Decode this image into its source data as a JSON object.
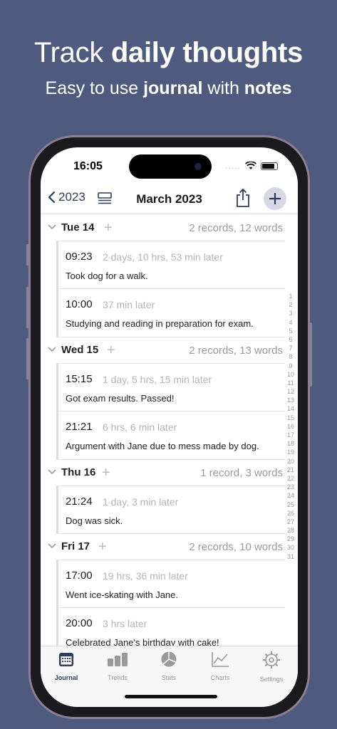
{
  "promo": {
    "title_plain": "Track ",
    "title_bold": "daily thoughts",
    "sub_plain": "Easy to use ",
    "sub_bold1": "journal",
    "sub_mid": " with ",
    "sub_bold2": "notes"
  },
  "status": {
    "time": "16:05",
    "dots": "....."
  },
  "nav": {
    "back_label": "2023",
    "title": "March 2023"
  },
  "days": [
    {
      "label": "Tue 14",
      "summary": "2 records, 12 words",
      "entries": [
        {
          "time": "09:23",
          "relative": "2 days, 10 hrs, 53 min later",
          "text": "Took dog for a walk."
        },
        {
          "time": "10:00",
          "relative": "37 min later",
          "text": "Studying and reading in preparation for exam."
        }
      ]
    },
    {
      "label": "Wed 15",
      "summary": "2 records, 13 words",
      "entries": [
        {
          "time": "15:15",
          "relative": "1 day, 5 hrs, 15 min later",
          "text": "Got exam results. Passed!"
        },
        {
          "time": "21:21",
          "relative": "6 hrs, 6 min later",
          "text": "Argument with Jane due to mess made by dog."
        }
      ]
    },
    {
      "label": "Thu 16",
      "summary": "1 record, 3 words",
      "entries": [
        {
          "time": "21:24",
          "relative": "1 day, 3 min later",
          "text": "Dog was sick."
        }
      ]
    },
    {
      "label": "Fri 17",
      "summary": "2 records, 10 words",
      "entries": [
        {
          "time": "17:00",
          "relative": "19 hrs, 36 min later",
          "text": "Went ice-skating with Jane."
        },
        {
          "time": "20:00",
          "relative": "3 hrs later",
          "text": "Celebrated Jane's birthday with cake!"
        }
      ]
    }
  ],
  "index": [
    "1",
    "2",
    "3",
    "4",
    "5",
    "6",
    "7",
    "8",
    "9",
    "10",
    "11",
    "12",
    "13",
    "14",
    "15",
    "16",
    "17",
    "18",
    "19",
    "20",
    "21",
    "22",
    "23",
    "24",
    "25",
    "26",
    "27",
    "28",
    "29",
    "30",
    "31"
  ],
  "tabs": [
    {
      "label": "Journal",
      "icon": "journal-icon",
      "active": true
    },
    {
      "label": "Trends",
      "icon": "trends-icon",
      "active": false
    },
    {
      "label": "Stats",
      "icon": "stats-icon",
      "active": false
    },
    {
      "label": "Charts",
      "icon": "charts-icon",
      "active": false
    },
    {
      "label": "Settings",
      "icon": "settings-icon",
      "active": false
    }
  ],
  "colors": {
    "background": "#4e5a7e",
    "accent": "#2f3a5f",
    "muted": "#9a9a9a"
  }
}
